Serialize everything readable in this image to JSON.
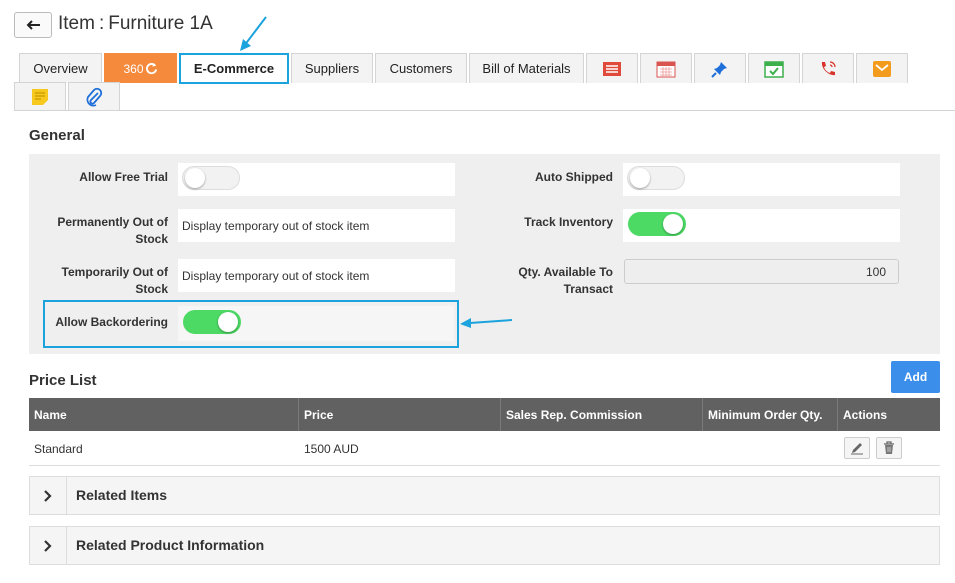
{
  "header": {
    "title_prefix": "Item",
    "title_sep": ":",
    "title_name": "Furniture 1A"
  },
  "tabs": [
    {
      "label": "Overview"
    },
    {
      "label": "360"
    },
    {
      "label": "E-Commerce"
    },
    {
      "label": "Suppliers"
    },
    {
      "label": "Customers"
    },
    {
      "label": "Bill of Materials"
    }
  ],
  "icon_tabs": [
    "invoice-icon",
    "calendar-icon",
    "pin-icon",
    "calendar-check-icon",
    "phone-icon",
    "envelope-icon",
    "sticky-note-icon",
    "paperclip-icon"
  ],
  "general": {
    "title": "General",
    "allow_free_trial": {
      "label": "Allow Free Trial",
      "on": false
    },
    "auto_shipped": {
      "label": "Auto Shipped",
      "on": false
    },
    "perm_oos": {
      "label_line1": "Permanently Out of",
      "label_line2": "Stock",
      "value": "Display temporary out of stock item"
    },
    "track_inventory": {
      "label": "Track Inventory",
      "on": true
    },
    "temp_oos": {
      "label_line1": "Temporarily Out of",
      "label_line2": "Stock",
      "value": "Display temporary out of stock item"
    },
    "qty_available": {
      "label_line1": "Qty. Available To",
      "label_line2": "Transact",
      "value": "100"
    },
    "allow_backordering": {
      "label": "Allow Backordering",
      "on": true
    }
  },
  "price_list": {
    "title": "Price List",
    "add_label": "Add",
    "columns": [
      "Name",
      "Price",
      "Sales Rep. Commission",
      "Minimum Order Qty.",
      "Actions"
    ],
    "rows": [
      {
        "name": "Standard",
        "price": "1500 AUD",
        "commission": "",
        "min_qty": ""
      }
    ]
  },
  "accordions": [
    {
      "label": "Related Items"
    },
    {
      "label": "Related Product Information"
    }
  ],
  "colors": {
    "accent_blue": "#1aa3dd",
    "toggle_on": "#4cd964",
    "tab_360": "#f58a3c",
    "add_button": "#3b8eea",
    "table_header": "#616161"
  }
}
